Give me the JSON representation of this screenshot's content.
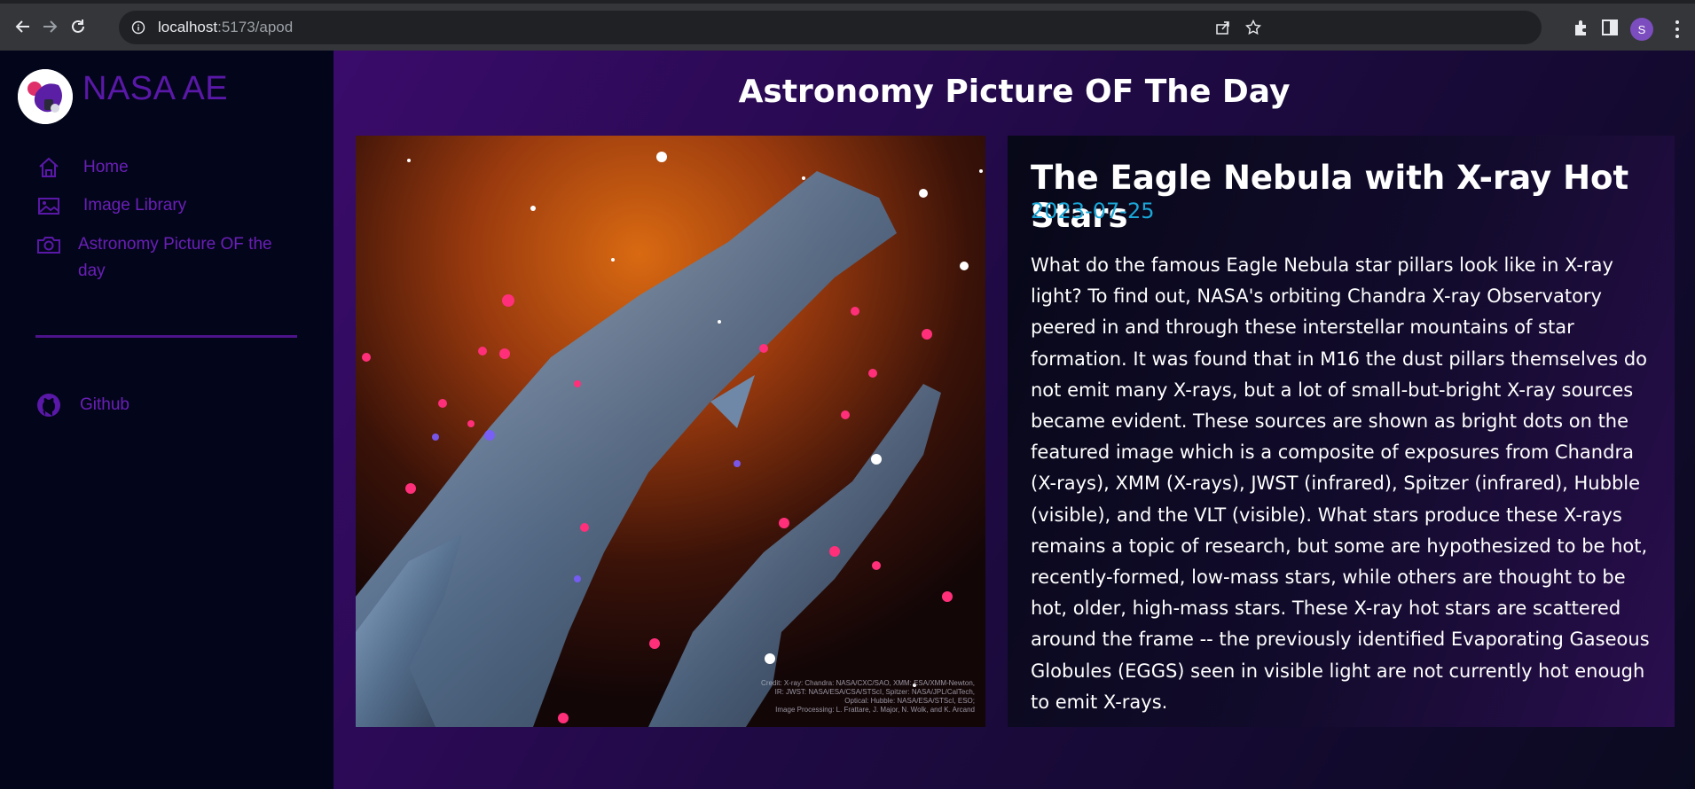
{
  "browser": {
    "url_host": "localhost",
    "url_rest": ":5173/apod",
    "profile_initial": "S"
  },
  "sidebar": {
    "brand": "NASA AE",
    "items": [
      {
        "label": "Home",
        "icon": "home-icon"
      },
      {
        "label": "Image Library",
        "icon": "image-icon"
      },
      {
        "label": "Astronomy Picture OF the",
        "label2": "day",
        "icon": "camera-icon"
      },
      {
        "label": "Github",
        "icon": "github-icon"
      }
    ]
  },
  "main": {
    "page_title": "Astronomy Picture OF The Day",
    "apod": {
      "title": "The Eagle Nebula with X-ray Hot Stars",
      "date": "2023-07-25",
      "explanation": "What do the famous Eagle Nebula star pillars look like in X-ray light? To find out, NASA's orbiting Chandra X-ray Observatory peered in and through these interstellar mountains of star formation. It was found that in M16 the dust pillars themselves do not emit many X-rays, but a lot of small-but-bright X-ray sources became evident. These sources are shown as bright dots on the featured image which is a composite of exposures from Chandra (X-rays), XMM (X-rays), JWST (infrared), Spitzer (infrared), Hubble (visible), and the VLT (visible). What stars produce these X-rays remains a topic of research, but some are hypothesized to be hot, recently-formed, low-mass stars, while others are thought to be hot, older, high-mass stars. These X-ray hot stars are scattered around the frame -- the previously identified Evaporating Gaseous Globules (EGGS) seen in visible light are not currently hot enough to emit X-rays.",
      "credit": "Credit: X-ray: Chandra: NASA/CXC/SAO, XMM: ESA/XMM-Newton,\nIR: JWST: NASA/ESA/CSA/STScI, Spitzer: NASA/JPL/CalTech,\nOptical: Hubble: NASA/ESA/STScI, ESO;\nImage Processing: L. Frattare, J. Major, N. Wolk, and K. Arcand"
    }
  },
  "colors": {
    "accent": "#6a1fb8",
    "date": "#1aa7d8",
    "sidebar_bg": "#03061a"
  }
}
